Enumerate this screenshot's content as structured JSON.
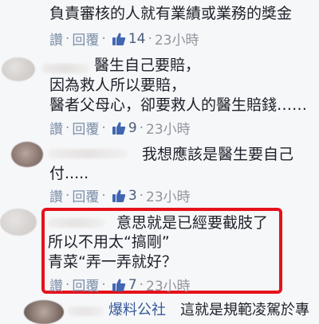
{
  "comments": [
    {
      "text_lines": [
        "負責審核的人就有業績或業務的獎金"
      ],
      "actions": {
        "like": "讚",
        "reply": "回覆",
        "likes": "14",
        "time": "23小時"
      }
    },
    {
      "text_lines": [
        "醫生自己要賠，",
        "因為救人所以要賠，",
        "醫者父母心，卻要救人的醫生賠錢……"
      ],
      "actions": {
        "like": "讚",
        "reply": "回覆",
        "likes": "9",
        "time": "23小時"
      }
    },
    {
      "text_lines": [
        "我想應該是醫生要自己",
        "付....."
      ],
      "actions": {
        "like": "讚",
        "reply": "回覆",
        "likes": "3",
        "time": "23小時"
      }
    },
    {
      "text_lines": [
        "意思就是已經要截肢了",
        "所以不用太“搞剛”",
        "青菜“弄一弄就好？"
      ],
      "actions": {
        "like": "讚",
        "reply": "回覆",
        "likes": "7",
        "time": "23小時"
      }
    },
    {
      "author": "爆料公社",
      "text_lines": [
        "這就是規範凌駕於專"
      ]
    }
  ],
  "colors": {
    "highlight": "#e5121b",
    "like_icon": "#4267b2",
    "link": "#365899"
  }
}
